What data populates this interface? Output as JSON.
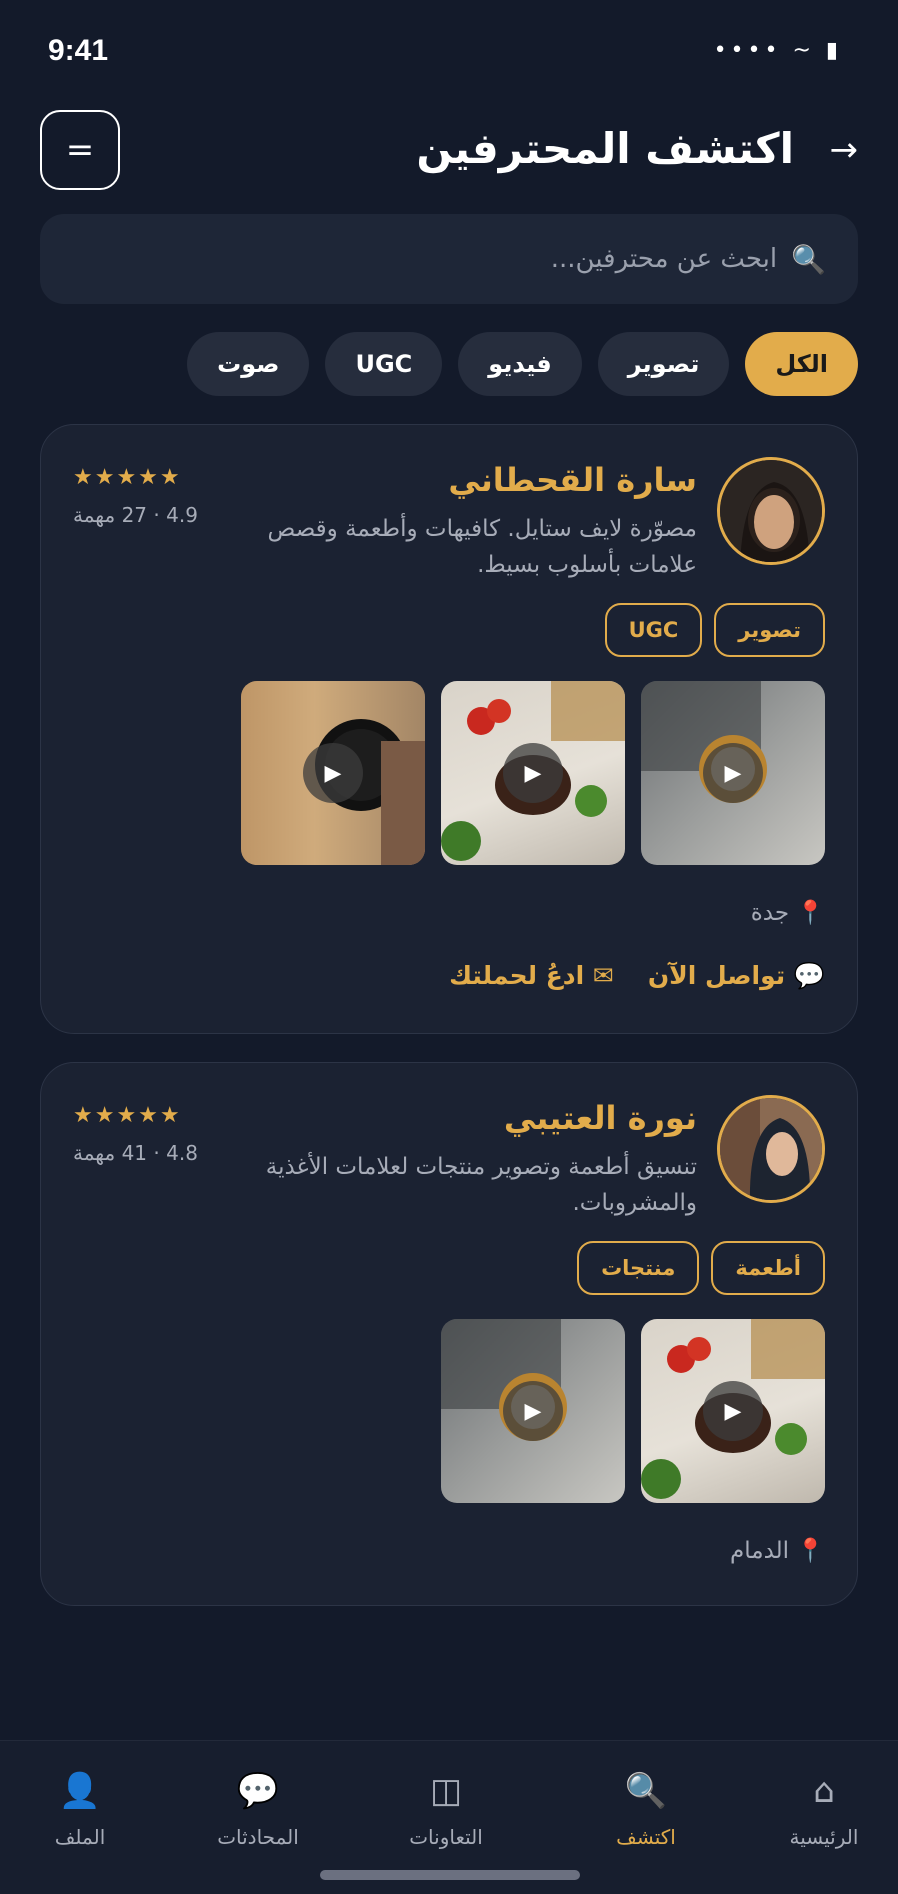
{
  "status": {
    "time": "9:41",
    "icons": "•••• ~ ▮"
  },
  "header": {
    "title": "اكتشف المحترفين",
    "back_icon": "→",
    "menu_icon": "="
  },
  "search": {
    "placeholder": "ابحث عن محترفين...",
    "icon": "🔍"
  },
  "filters": [
    {
      "label": "الكل",
      "active": true
    },
    {
      "label": "تصوير",
      "active": false
    },
    {
      "label": "فيديو",
      "active": false
    },
    {
      "label": "UGC",
      "active": false
    },
    {
      "label": "صوت",
      "active": false
    }
  ],
  "creators": [
    {
      "name": "سارة القحطاني",
      "bio": "مصوّرة لايف ستايل. كافيهات وأطعمة وقصص علامات بأسلوب بسيط.",
      "stars": "★★★★★",
      "rating": "4.9 · 27 مهمة",
      "tags": [
        "تصوير",
        "UGC"
      ],
      "location": "📍 جدة",
      "actions": {
        "contact": "💬 تواصل الآن",
        "invite": "✉ ادعُ لحملتك"
      }
    },
    {
      "name": "نورة العتيبي",
      "bio": "تنسيق أطعمة وتصوير منتجات لعلامات الأغذية والمشروبات.",
      "stars": "★★★★★",
      "rating": "4.8 · 41 مهمة",
      "tags": [
        "أطعمة",
        "منتجات"
      ],
      "location": "📍 الدمام"
    }
  ],
  "play_icon": "▶",
  "nav": [
    {
      "label": "الرئيسية",
      "icon": "⌂"
    },
    {
      "label": "اكتشف",
      "icon": "🔍",
      "active": true
    },
    {
      "label": "التعاونات",
      "icon": "◫"
    },
    {
      "label": "المحادثات",
      "icon": "💬"
    },
    {
      "label": "الملف",
      "icon": "👤"
    }
  ],
  "colors": {
    "accent": "#e2ac4b",
    "background": "#131a2a",
    "card": "#1b2232"
  }
}
